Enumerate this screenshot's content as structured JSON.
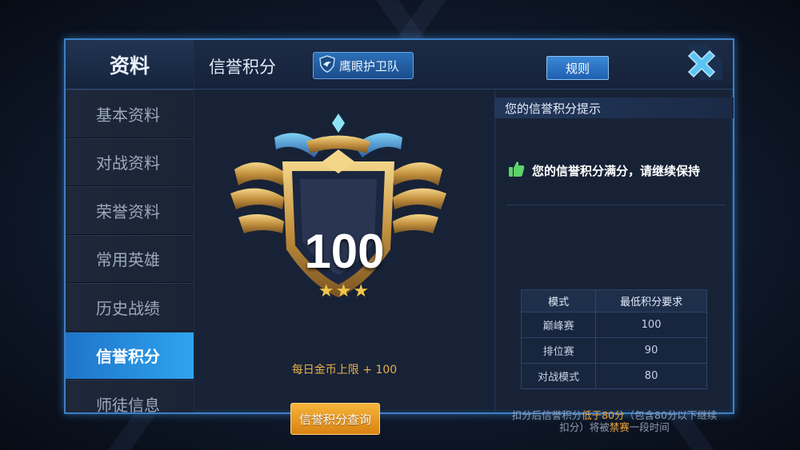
{
  "sidebar": {
    "title": "资料",
    "items": [
      {
        "label": "基本资料"
      },
      {
        "label": "对战资料"
      },
      {
        "label": "荣誉资料"
      },
      {
        "label": "常用英雄"
      },
      {
        "label": "历史战绩"
      },
      {
        "label": "信誉积分",
        "active": true
      },
      {
        "label": "师徒信息"
      }
    ]
  },
  "header": {
    "title": "信誉积分",
    "hawk_button": "鹰眼护卫队",
    "rule_button": "规则",
    "close_icon": "close-x-icon"
  },
  "center": {
    "score": "100",
    "stars": "★★★",
    "gold_limit": "每日金币上限 + 100",
    "query_button": "信誉积分查询"
  },
  "right": {
    "tip_title": "您的信誉积分提示",
    "tip_message": "您的信誉积分满分，请继续保持",
    "tip_icon": "thumbs-up-icon",
    "table": {
      "headers": [
        "模式",
        "最低积分要求"
      ],
      "rows": [
        [
          "巅峰赛",
          "100"
        ],
        [
          "排位赛",
          "90"
        ],
        [
          "对战模式",
          "80"
        ]
      ]
    },
    "note": {
      "part1": "扣分后信誉积分",
      "highlight1": "低于80分",
      "part2": "（包含80分以下继续扣分）将被",
      "highlight2": "禁赛",
      "part3": "一段时间"
    }
  },
  "colors": {
    "accent_blue": "#2ea4ef",
    "gold": "#f6b43a",
    "highlight_orange": "#f1a63b"
  }
}
